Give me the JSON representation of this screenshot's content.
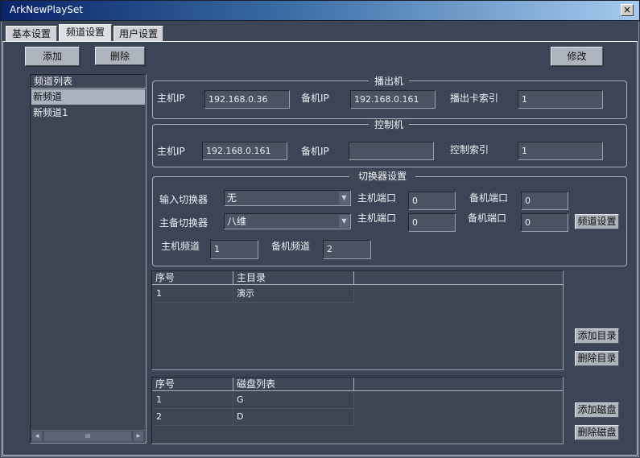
{
  "window": {
    "title": "ArkNewPlaySet",
    "close_glyph": "×"
  },
  "tabs": [
    {
      "label": "基本设置"
    },
    {
      "label": "频道设置"
    },
    {
      "label": "用户设置"
    }
  ],
  "toolbar": {
    "add_label": "添加",
    "delete_label": "删除",
    "modify_label": "修改"
  },
  "channel_list": {
    "header": "频道列表",
    "items": [
      "新频道",
      "新频道1"
    ],
    "scroll_thumb": "III"
  },
  "playout": {
    "title": "播出机",
    "main_ip_label": "主机IP",
    "main_ip_value": "192.168.0.36",
    "backup_ip_label": "备机IP",
    "backup_ip_value": "192.168.0.161",
    "card_index_label": "播出卡索引",
    "card_index_value": "1"
  },
  "control": {
    "title": "控制机",
    "main_ip_label": "主机IP",
    "main_ip_value": "192.168.0.161",
    "backup_ip_label": "备机IP",
    "backup_ip_value": "",
    "control_index_label": "控制索引",
    "control_index_value": "1"
  },
  "switcher": {
    "title": "切换器设置",
    "input_switcher_label": "输入切换器",
    "input_switcher_value": "无",
    "main_port_label": "主机端口",
    "backup_port_label": "备机端口",
    "input_main_port": "0",
    "input_backup_port": "0",
    "mb_switcher_label": "主备切换器",
    "mb_switcher_value": "八维",
    "mb_main_port": "0",
    "mb_backup_port": "0",
    "channel_settings_label": "频道设置",
    "main_channel_label": "主机频道",
    "main_channel_value": "1",
    "backup_channel_label": "备机频道",
    "backup_channel_value": "2"
  },
  "dir_table": {
    "headers": [
      "序号",
      "主目录"
    ],
    "rows": [
      [
        "1",
        "演示"
      ]
    ],
    "add_label": "添加目录",
    "delete_label": "删除目录"
  },
  "disk_table": {
    "headers": [
      "序号",
      "磁盘列表"
    ],
    "rows": [
      [
        "1",
        "G"
      ],
      [
        "2",
        "D"
      ]
    ],
    "add_label": "添加磁盘",
    "delete_label": "删除磁盘"
  },
  "icons": {
    "combo_arrow": "▼",
    "scroll_left": "◂",
    "scroll_right": "▸"
  }
}
